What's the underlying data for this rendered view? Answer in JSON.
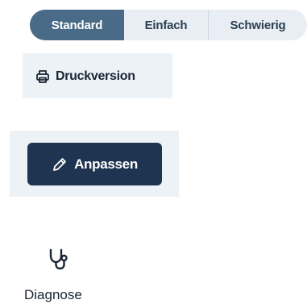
{
  "difficulty": {
    "options": [
      "Standard",
      "Einfach",
      "Schwierig"
    ],
    "selected": "Standard"
  },
  "print": {
    "label": "Druckversion",
    "icon": "printer-icon"
  },
  "adjust": {
    "label": "Anpassen",
    "icon": "pencil-icon"
  },
  "diagnose": {
    "label": "Diagnose",
    "icon": "stethoscope-icon"
  },
  "colors": {
    "segment_active": "#4a6b88",
    "segment_bg": "#e8eef4",
    "panel_bg": "#edf2f7",
    "primary_button": "#1e3450"
  }
}
